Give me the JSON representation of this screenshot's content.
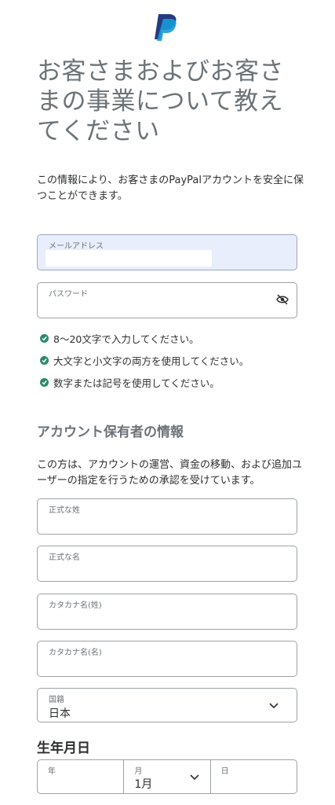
{
  "brand": {
    "logo_icon": "paypal-logo-icon",
    "colors": {
      "dark": "#253b80",
      "light": "#179bd7"
    }
  },
  "headline": "お客さまおよびお客さまの事業について教えてください",
  "intro": "この情報により、お客さまのPayPalアカウントを安全に保つことができます。",
  "email": {
    "label": "メールアドレス",
    "value": ""
  },
  "password": {
    "label": "パスワード",
    "value": "",
    "toggle_icon": "eye-hidden-icon"
  },
  "requirements": [
    "8～20文字で入力してください。",
    "大文字と小文字の両方を使用してください。",
    "数字または記号を使用してください。"
  ],
  "holder_section": {
    "title": "アカウント保有者の情報",
    "description": "この方は、アカウントの運営、資金の移動、および追加ユーザーの指定を行うための承認を受けています。"
  },
  "fields": {
    "last_name": {
      "label": "正式な姓",
      "value": ""
    },
    "first_name": {
      "label": "正式な名",
      "value": ""
    },
    "kana_last": {
      "label": "カタカナ名(姓)",
      "value": ""
    },
    "kana_first": {
      "label": "カタカナ名(名)",
      "value": ""
    },
    "nationality": {
      "label": "国籍",
      "value": "日本"
    }
  },
  "dob": {
    "title": "生年月日",
    "year": {
      "label": "年",
      "value": ""
    },
    "month": {
      "label": "月",
      "value": "1月"
    },
    "day": {
      "label": "日",
      "value": ""
    }
  },
  "colors": {
    "check": "#2b8a6e",
    "accent_fill": "#e8eefb"
  }
}
